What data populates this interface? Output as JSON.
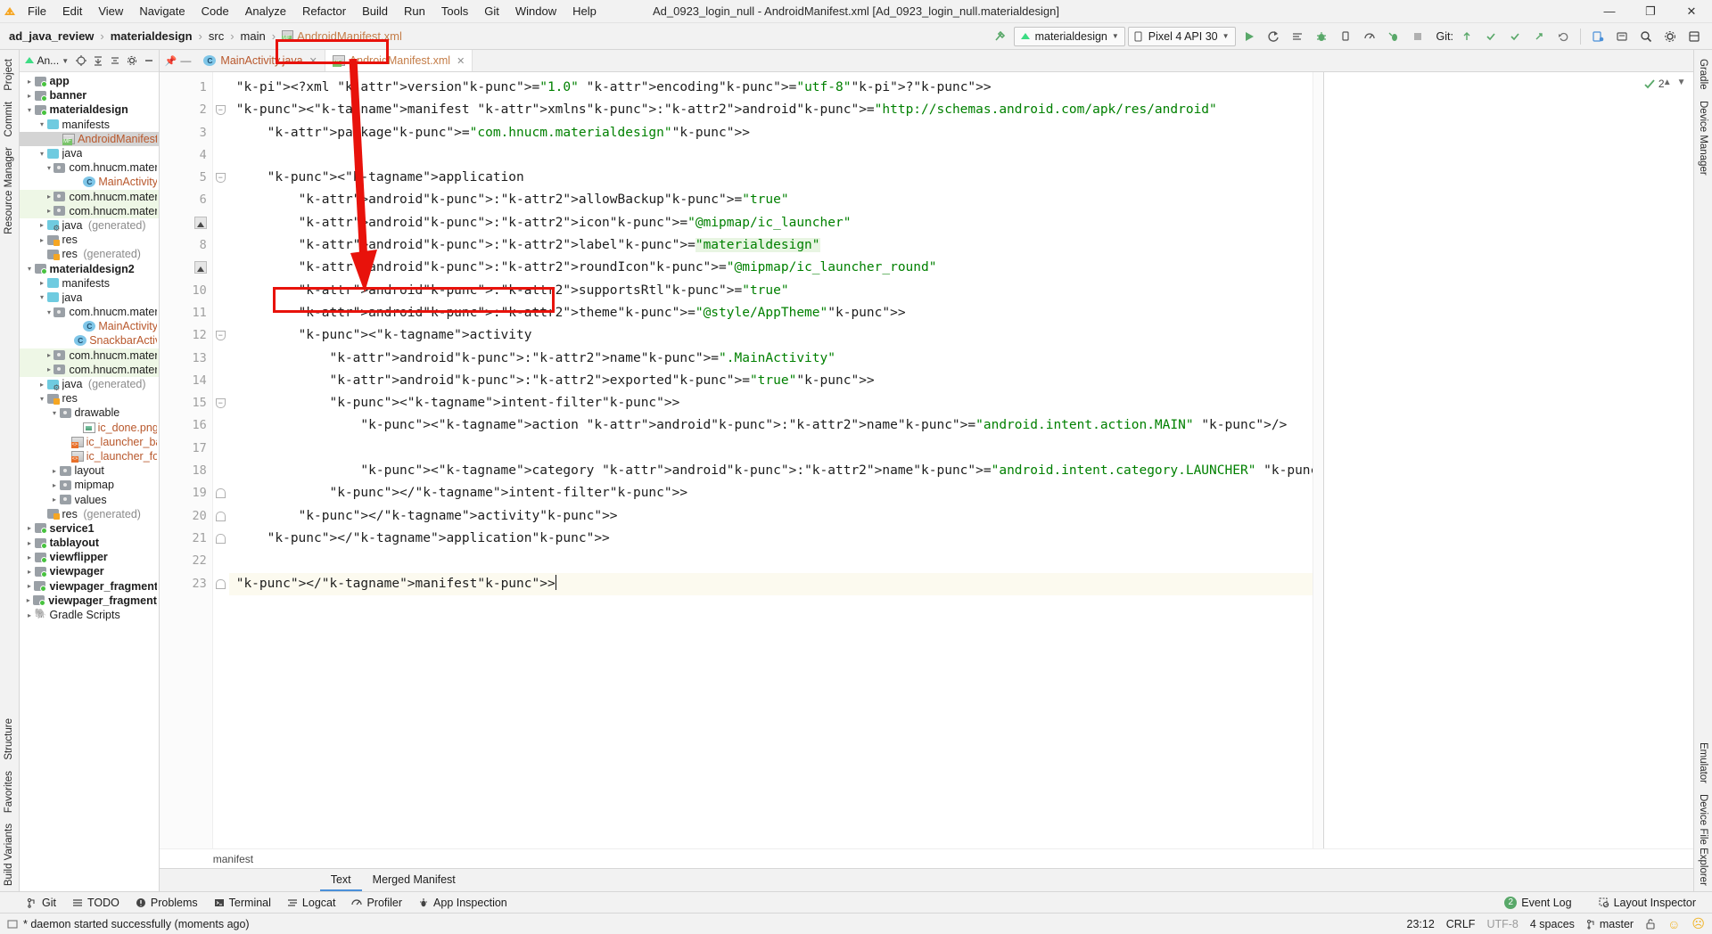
{
  "window": {
    "title": "Ad_0923_login_null - AndroidManifest.xml [Ad_0923_login_null.materialdesign]",
    "minimize": "—",
    "maximize": "❐",
    "close": "✕"
  },
  "menubar": [
    {
      "label": "File"
    },
    {
      "label": "Edit"
    },
    {
      "label": "View"
    },
    {
      "label": "Navigate"
    },
    {
      "label": "Code"
    },
    {
      "label": "Analyze"
    },
    {
      "label": "Refactor"
    },
    {
      "label": "Build"
    },
    {
      "label": "Run"
    },
    {
      "label": "Tools"
    },
    {
      "label": "Git"
    },
    {
      "label": "Window"
    },
    {
      "label": "Help"
    }
  ],
  "breadcrumb": [
    {
      "label": "ad_java_review",
      "bold": true
    },
    {
      "label": "materialdesign",
      "bold": true
    },
    {
      "label": "src",
      "bold": false
    },
    {
      "label": "main",
      "bold": false
    },
    {
      "label": "AndroidManifest.xml",
      "file": true
    }
  ],
  "toolbar": {
    "run_config": "materialdesign",
    "device": "Pixel 4 API 30",
    "git_label": "Git:",
    "icons": [
      "hammer-icon",
      "run-icon",
      "apply-changes-icon",
      "restart-icon",
      "debug-icon",
      "attach-debugger-icon",
      "profiler-icon",
      "run-with-coverage-icon",
      "stop-icon",
      "search-everywhere-icon",
      "settings-icon",
      "project-structure-icon"
    ]
  },
  "project_panel": {
    "title": "An...",
    "header_icons": [
      "locate-icon",
      "collapse-expand-icon",
      "collapse-all-icon",
      "settings-icon",
      "hide-icon"
    ],
    "tree": [
      {
        "indent": 0,
        "arrow": "closed",
        "icon": "folder-mod",
        "label": "app",
        "bold": true
      },
      {
        "indent": 0,
        "arrow": "closed",
        "icon": "folder-mod",
        "label": "banner",
        "bold": true
      },
      {
        "indent": 0,
        "arrow": "open",
        "icon": "folder-mod",
        "label": "materialdesign",
        "bold": true
      },
      {
        "indent": 1,
        "arrow": "open",
        "icon": "folder-blue",
        "label": "manifests"
      },
      {
        "indent": 3,
        "arrow": "none",
        "icon": "mf",
        "label": "AndroidManifest.xml",
        "orange": true,
        "selected": true
      },
      {
        "indent": 1,
        "arrow": "open",
        "icon": "folder-blue",
        "label": "java"
      },
      {
        "indent": 2,
        "arrow": "open",
        "icon": "folder-gray",
        "label": "com.hnucm.materiald"
      },
      {
        "indent": 4,
        "arrow": "none",
        "icon": "class",
        "label": "MainActivity",
        "orange": true
      },
      {
        "indent": 2,
        "arrow": "closed",
        "icon": "folder-gray",
        "label": "com.hnucm.materiald",
        "green": true
      },
      {
        "indent": 2,
        "arrow": "closed",
        "icon": "folder-gray",
        "label": "com.hnucm.materiald",
        "green": true
      },
      {
        "indent": 1,
        "arrow": "closed",
        "icon": "folder-gen",
        "label": "java",
        "suffix": " (generated)"
      },
      {
        "indent": 1,
        "arrow": "closed",
        "icon": "folder-res",
        "label": "res"
      },
      {
        "indent": 1,
        "arrow": "none",
        "icon": "folder-res",
        "label": "res",
        "suffix": " (generated)"
      },
      {
        "indent": 0,
        "arrow": "open",
        "icon": "folder-mod",
        "label": "materialdesign2",
        "bold": true
      },
      {
        "indent": 1,
        "arrow": "closed",
        "icon": "folder-blue",
        "label": "manifests"
      },
      {
        "indent": 1,
        "arrow": "open",
        "icon": "folder-blue",
        "label": "java"
      },
      {
        "indent": 2,
        "arrow": "open",
        "icon": "folder-gray",
        "label": "com.hnucm.materiald"
      },
      {
        "indent": 4,
        "arrow": "none",
        "icon": "class",
        "label": "MainActivity",
        "orange": true
      },
      {
        "indent": 4,
        "arrow": "none",
        "icon": "class",
        "label": "SnackbarActivity",
        "orange": true
      },
      {
        "indent": 2,
        "arrow": "closed",
        "icon": "folder-gray",
        "label": "com.hnucm.materiald",
        "green": true
      },
      {
        "indent": 2,
        "arrow": "closed",
        "icon": "folder-gray",
        "label": "com.hnucm.materiald",
        "green": true
      },
      {
        "indent": 1,
        "arrow": "closed",
        "icon": "folder-gen",
        "label": "java",
        "suffix": " (generated)"
      },
      {
        "indent": 1,
        "arrow": "open",
        "icon": "folder-res",
        "label": "res"
      },
      {
        "indent": 2,
        "arrow": "open",
        "icon": "folder-gray",
        "label": "drawable"
      },
      {
        "indent": 4,
        "arrow": "none",
        "icon": "png",
        "label": "ic_done.png",
        "orange": true
      },
      {
        "indent": 4,
        "arrow": "none",
        "icon": "xmlfile",
        "label": "ic_launcher_backg",
        "orange": true
      },
      {
        "indent": 4,
        "arrow": "none",
        "icon": "xmlfile",
        "label": "ic_launcher_foregr",
        "orange": true
      },
      {
        "indent": 2,
        "arrow": "closed",
        "icon": "folder-gray",
        "label": "layout"
      },
      {
        "indent": 2,
        "arrow": "closed",
        "icon": "folder-gray",
        "label": "mipmap"
      },
      {
        "indent": 2,
        "arrow": "closed",
        "icon": "folder-gray",
        "label": "values"
      },
      {
        "indent": 1,
        "arrow": "none",
        "icon": "folder-res",
        "label": "res",
        "suffix": " (generated)"
      },
      {
        "indent": 0,
        "arrow": "closed",
        "icon": "folder-mod",
        "label": "service1",
        "bold": true
      },
      {
        "indent": 0,
        "arrow": "closed",
        "icon": "folder-mod",
        "label": "tablayout",
        "bold": true
      },
      {
        "indent": 0,
        "arrow": "closed",
        "icon": "folder-mod",
        "label": "viewflipper",
        "bold": true
      },
      {
        "indent": 0,
        "arrow": "closed",
        "icon": "folder-mod",
        "label": "viewpager",
        "bold": true
      },
      {
        "indent": 0,
        "arrow": "closed",
        "icon": "folder-mod",
        "label": "viewpager_fragment",
        "bold": true
      },
      {
        "indent": 0,
        "arrow": "closed",
        "icon": "folder-mod",
        "label": "viewpager_fragment_bott",
        "bold": true
      },
      {
        "indent": 0,
        "arrow": "closed",
        "icon": "gradle",
        "label": "Gradle Scripts"
      }
    ]
  },
  "left_strip": [
    {
      "label": "Project"
    },
    {
      "label": "Commit"
    },
    {
      "label": "Resource Manager"
    }
  ],
  "right_strip": [
    {
      "label": "Gradle"
    },
    {
      "label": "Device Manager"
    },
    {
      "label": "Emulator"
    },
    {
      "label": "Device File Explorer"
    }
  ],
  "bottom_left_strip": [
    {
      "label": "Structure"
    },
    {
      "label": "Favorites"
    },
    {
      "label": "Build Variants"
    }
  ],
  "editor": {
    "tabs": [
      {
        "label": "MainActivity.java",
        "icon": "java-class-icon",
        "active": false,
        "close": "✕"
      },
      {
        "label": "AndroidManifest.xml",
        "icon": "manifest-icon",
        "active": true,
        "close": "✕"
      }
    ],
    "inspection_count": "2",
    "line_numbers": [
      "1",
      "2",
      "3",
      "4",
      "5",
      "6",
      "7",
      "8",
      "9",
      "10",
      "11",
      "12",
      "13",
      "14",
      "15",
      "16",
      "17",
      "18",
      "19",
      "20",
      "21",
      "22",
      "23"
    ],
    "lines": [
      "<?xml version=\"1.0\" encoding=\"utf-8\"?>",
      "<manifest xmlns:android=\"http://schemas.android.com/apk/res/android\"",
      "    package=\"com.hnucm.materialdesign\">",
      "",
      "    <application",
      "        android:allowBackup=\"true\"",
      "        android:icon=\"@mipmap/ic_launcher\"",
      "        android:label=\"materialdesign\"",
      "        android:roundIcon=\"@mipmap/ic_launcher_round\"",
      "        android:supportsRtl=\"true\"",
      "        android:theme=\"@style/AppTheme\">",
      "        <activity",
      "            android:name=\".MainActivity\"",
      "            android:exported=\"true\">",
      "            <intent-filter>",
      "                <action android:name=\"android.intent.action.MAIN\" />",
      "",
      "                <category android:name=\"android.intent.category.LAUNCHER\" />",
      "            </intent-filter>",
      "        </activity>",
      "    </application>",
      "",
      "</manifest>"
    ],
    "status_breadcrumb": "manifest",
    "design_tabs": [
      {
        "label": "Text",
        "active": true
      },
      {
        "label": "Merged Manifest",
        "active": false
      }
    ]
  },
  "bottom_toolwindows": [
    {
      "label": "Git",
      "icon": "git-branch-icon"
    },
    {
      "label": "TODO",
      "icon": "todo-list-icon"
    },
    {
      "label": "Problems",
      "icon": "problems-icon"
    },
    {
      "label": "Terminal",
      "icon": "terminal-icon"
    },
    {
      "label": "Logcat",
      "icon": "logcat-icon"
    },
    {
      "label": "Profiler",
      "icon": "profiler-icon"
    },
    {
      "label": "App Inspection",
      "icon": "app-inspection-icon"
    }
  ],
  "bottom_right": [
    {
      "label": "Event Log",
      "badge": "2",
      "icon": "event-log-icon"
    },
    {
      "label": "Layout Inspector",
      "icon": "layout-inspector-icon"
    }
  ],
  "statusbar": {
    "message": "* daemon started successfully (moments ago)",
    "message_icon": "console-icon",
    "position": "23:12",
    "line_sep": "CRLF",
    "encoding": "UTF-8",
    "indent": "4 spaces",
    "branch": "master",
    "branch_icon": "git-branch-icon",
    "lock_icon": "unlocked-icon",
    "smiley1": "☺",
    "smiley2": "☹"
  },
  "colors": {
    "accent": "#4a90d9",
    "annotation_red": "#e8120b",
    "tag": "#0033b3",
    "attribute": "#9c27b0",
    "value": "#008000",
    "selection": "#d4d4d4",
    "green_row": "#eef7e6",
    "badge_green": "#59a869"
  }
}
